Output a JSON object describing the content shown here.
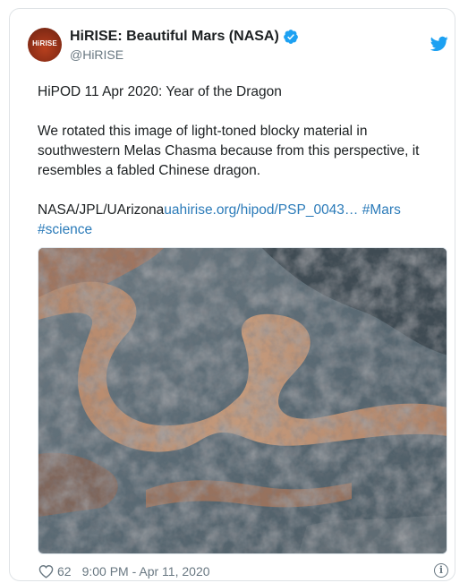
{
  "tweet": {
    "author_name": "HiRISE: Beautiful Mars (NASA)",
    "handle": "@HiRISE",
    "avatar_text": "HiRISE",
    "line1": "HiPOD 11 Apr 2020: Year of the Dragon",
    "body": "We rotated this image of light-toned blocky material in southwestern Melas Chasma because from this perspective, it resembles a fabled Chinese dragon.",
    "credit": "NASA/JPL/UArizona",
    "url": "uahirise.org/hipod/PSP_0043…",
    "hashtag1": "#Mars",
    "hashtag2": "#science"
  },
  "footer": {
    "likes": "62",
    "timestamp": "9:00 PM - Apr 11, 2020",
    "info_glyph": "i"
  },
  "colors": {
    "link": "#2b7bb9",
    "verified": "#1da1f2",
    "twitter_brand": "#1da1f2",
    "muted": "#697882"
  },
  "icons": [
    "verified-badge-icon",
    "twitter-bird-icon",
    "heart-icon",
    "info-icon"
  ]
}
